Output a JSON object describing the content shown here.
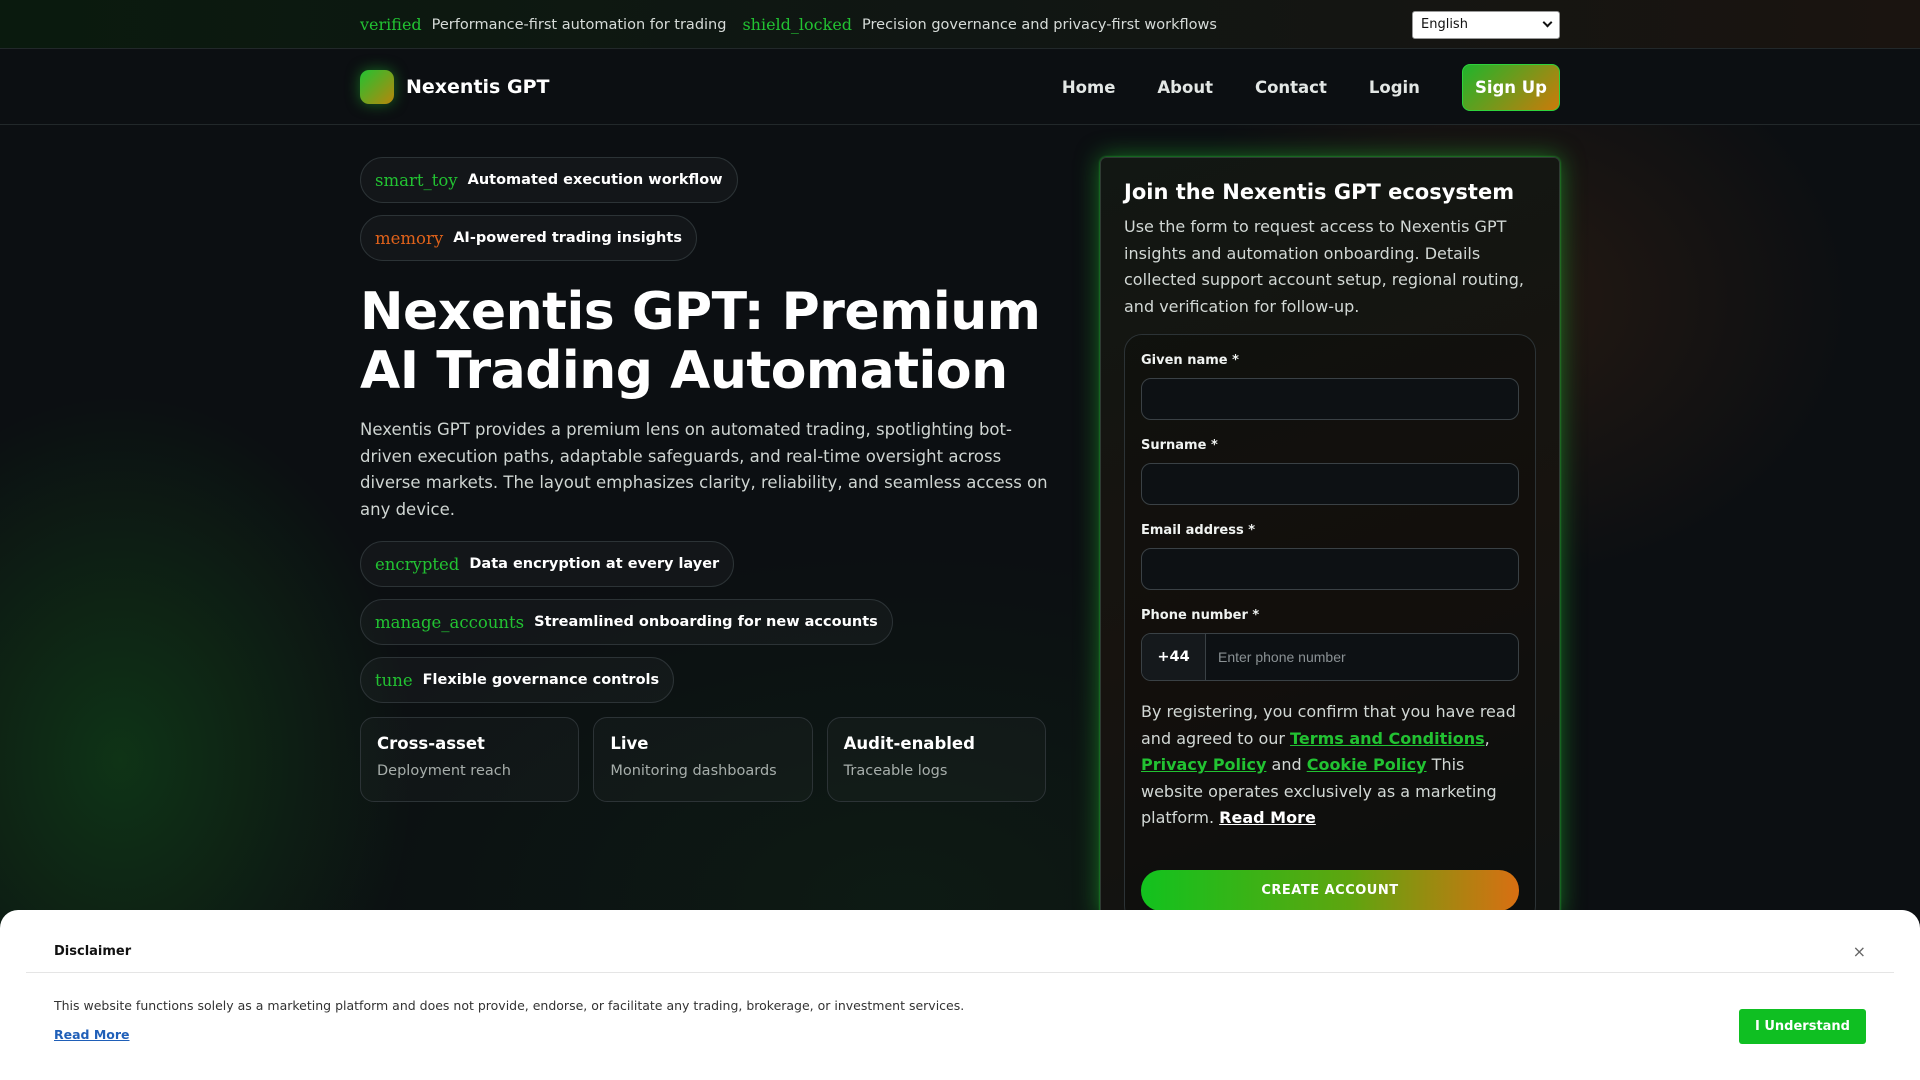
{
  "topbar": {
    "items": [
      {
        "icon": "verified",
        "text": "Performance-first automation for trading"
      },
      {
        "icon": "shield_locked",
        "text": "Precision governance and privacy-first workflows"
      }
    ],
    "language": "English"
  },
  "nav": {
    "brand": "Nexentis GPT",
    "links": [
      "Home",
      "About",
      "Contact",
      "Login"
    ],
    "signup": "Sign Up"
  },
  "hero": {
    "pills": [
      {
        "icon": "smart_toy",
        "text": "Automated execution workflow",
        "color": "#22c232"
      },
      {
        "icon": "memory",
        "text": "AI-powered trading insights",
        "color": "#e0621a"
      }
    ],
    "title": "Nexentis GPT: Premium AI Trading Automation",
    "description": "Nexentis GPT provides a premium lens on automated trading, spotlighting bot-driven execution paths, adaptable safeguards, and real-time oversight across diverse markets. The layout emphasizes clarity, reliability, and seamless access on any device.",
    "features": [
      {
        "icon": "encrypted",
        "text": "Data encryption at every layer"
      },
      {
        "icon": "manage_accounts",
        "text": "Streamlined onboarding for new accounts"
      },
      {
        "icon": "tune",
        "text": "Flexible governance controls"
      }
    ],
    "stats": [
      {
        "title": "Cross-asset",
        "sub": "Deployment reach"
      },
      {
        "title": "Live",
        "sub": "Monitoring dashboards"
      },
      {
        "title": "Audit-enabled",
        "sub": "Traceable logs"
      }
    ]
  },
  "form": {
    "title": "Join the Nexentis GPT ecosystem",
    "description": "Use the form to request access to Nexentis GPT insights and automation onboarding. Details collected support account setup, regional routing, and verification for follow-up.",
    "given_name_label": "Given name *",
    "surname_label": "Surname *",
    "email_label": "Email address *",
    "phone_label": "Phone number *",
    "phone_code": "+44",
    "phone_placeholder": "Enter phone number",
    "consent_prefix": "By registering, you confirm that you have read and agreed to our ",
    "terms": "Terms and Conditions",
    "comma": ",",
    "privacy": "Privacy Policy",
    "and": " and ",
    "cookie": "Cookie Policy",
    "consent_suffix": " This website operates exclusively as a marketing platform. ",
    "read_more": "Read More",
    "submit": "CREATE ACCOUNT"
  },
  "disclaimer": {
    "title": "Disclaimer",
    "close": "×",
    "text": "This website functions solely as a marketing platform and does not provide, endorse, or facilitate any trading, brokerage, or investment services.",
    "read_more": "Read More",
    "button": "I Understand"
  }
}
